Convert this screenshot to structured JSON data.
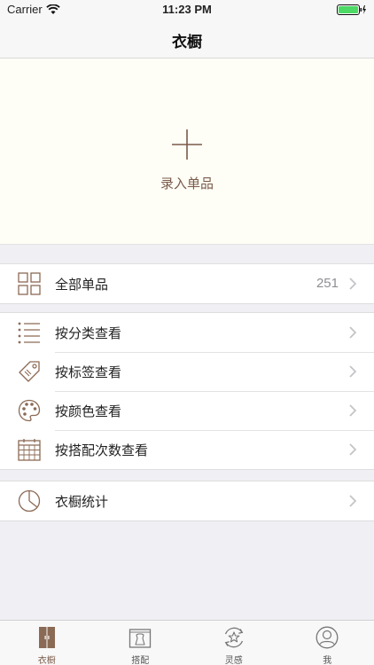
{
  "status_bar": {
    "carrier": "Carrier",
    "time": "11:23 PM"
  },
  "nav": {
    "title": "衣橱"
  },
  "add_item": {
    "label": "录入单品"
  },
  "all_items": {
    "label": "全部单品",
    "count": "251"
  },
  "browse": [
    {
      "label": "按分类查看"
    },
    {
      "label": "按标签查看"
    },
    {
      "label": "按颜色查看"
    },
    {
      "label": "按搭配次数查看"
    }
  ],
  "stats": {
    "label": "衣橱统计"
  },
  "tabs": [
    {
      "label": "衣橱",
      "icon": "wardrobe-icon"
    },
    {
      "label": "搭配",
      "icon": "outfit-icon"
    },
    {
      "label": "灵感",
      "icon": "inspiration-icon"
    },
    {
      "label": "我",
      "icon": "profile-icon"
    }
  ],
  "colors": {
    "accent": "#7a5a4a",
    "icon": "#8b6a55",
    "battery": "#4cd964"
  }
}
